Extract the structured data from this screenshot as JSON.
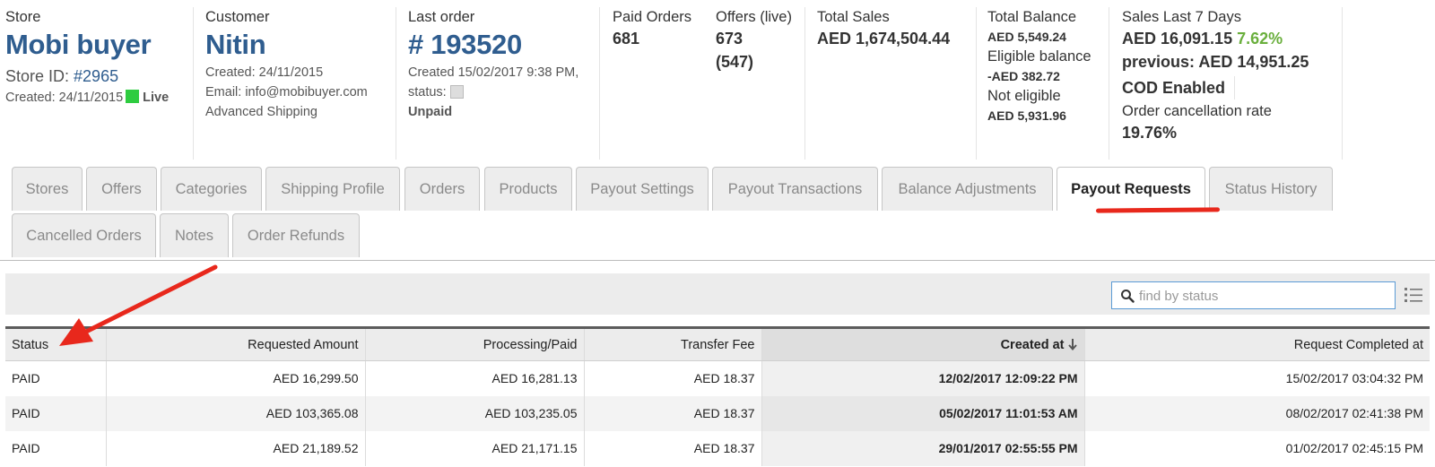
{
  "store": {
    "label": "Store",
    "name": "Mobi buyer",
    "id_prefix": "Store ID: ",
    "id": "#2965",
    "created": "Created: 24/11/2015",
    "live": "Live"
  },
  "customer": {
    "label": "Customer",
    "name": "Nitin",
    "created": "Created: 24/11/2015",
    "email": "Email: info@mobibuyer.com",
    "shipping": "Advanced Shipping"
  },
  "last_order": {
    "label": "Last order",
    "number": "# 193520",
    "created": "Created 15/02/2017 9:38 PM,",
    "status_label": "status:",
    "status": "Unpaid"
  },
  "paid_orders": {
    "label": "Paid Orders",
    "value": "681"
  },
  "offers": {
    "label": "Offers (live)",
    "value": "673",
    "live": "(547)"
  },
  "total_sales": {
    "label": "Total Sales",
    "value": "AED 1,674,504.44"
  },
  "total_balance": {
    "label": "Total Balance",
    "value": "AED 5,549.24",
    "eligible_label": "Eligible balance",
    "eligible_value": "-AED 382.72",
    "not_eligible_label": "Not eligible",
    "not_eligible_value": "AED 5,931.96"
  },
  "sales_7days": {
    "label": "Sales Last 7 Days",
    "value": "AED 16,091.15",
    "change": "7.62%",
    "previous": "previous: AED 14,951.25",
    "cod": "COD Enabled",
    "cancel_label": "Order cancellation rate",
    "cancel_value": "19.76%"
  },
  "tabs": [
    {
      "label": "Stores"
    },
    {
      "label": "Offers"
    },
    {
      "label": "Categories"
    },
    {
      "label": "Shipping Profile"
    },
    {
      "label": "Orders"
    },
    {
      "label": "Products"
    },
    {
      "label": "Payout Settings"
    },
    {
      "label": "Payout Transactions"
    },
    {
      "label": "Balance Adjustments"
    },
    {
      "label": "Payout Requests"
    },
    {
      "label": "Status History"
    },
    {
      "label": "Cancelled Orders"
    },
    {
      "label": "Notes"
    },
    {
      "label": "Order Refunds"
    }
  ],
  "active_tab": "Payout Requests",
  "search": {
    "placeholder": "find by status"
  },
  "table": {
    "columns": [
      "Status",
      "Requested Amount",
      "Processing/Paid",
      "Transfer Fee",
      "Created at",
      "Request Completed at"
    ],
    "sorted_column": "Created at",
    "rows": [
      [
        "PAID",
        "AED 16,299.50",
        "AED 16,281.13",
        "AED 18.37",
        "12/02/2017 12:09:22 PM",
        "15/02/2017 03:04:32 PM"
      ],
      [
        "PAID",
        "AED 103,365.08",
        "AED 103,235.05",
        "AED 18.37",
        "05/02/2017 11:01:53 AM",
        "08/02/2017 02:41:38 PM"
      ],
      [
        "PAID",
        "AED 21,189.52",
        "AED 21,171.15",
        "AED 18.37",
        "29/01/2017 02:55:55 PM",
        "01/02/2017 02:45:15 PM"
      ]
    ]
  },
  "colors": {
    "link": "#2f5d8f",
    "live": "#2ecc40",
    "positive": "#6aaf3d",
    "annotation": "#e8281c",
    "search_border": "#5b9bd5"
  }
}
